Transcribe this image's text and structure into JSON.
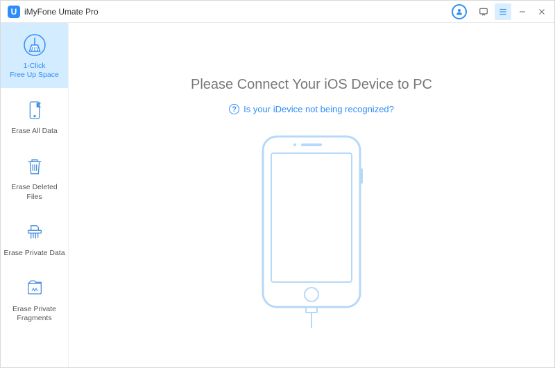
{
  "app": {
    "title": "iMyFone Umate Pro",
    "logo_letter": "U"
  },
  "sidebar": {
    "items": [
      {
        "label": "1-Click\nFree Up Space",
        "name": "sidebar-item-free-up-space",
        "active": true
      },
      {
        "label": "Erase All Data",
        "name": "sidebar-item-erase-all-data",
        "active": false
      },
      {
        "label": "Erase Deleted Files",
        "name": "sidebar-item-erase-deleted-files",
        "active": false
      },
      {
        "label": "Erase Private Data",
        "name": "sidebar-item-erase-private-data",
        "active": false
      },
      {
        "label": "Erase Private\nFragments",
        "name": "sidebar-item-erase-private-fragments",
        "active": false
      }
    ]
  },
  "main": {
    "title": "Please Connect Your iOS Device to PC",
    "help_text": "Is your iDevice not being recognized?"
  }
}
